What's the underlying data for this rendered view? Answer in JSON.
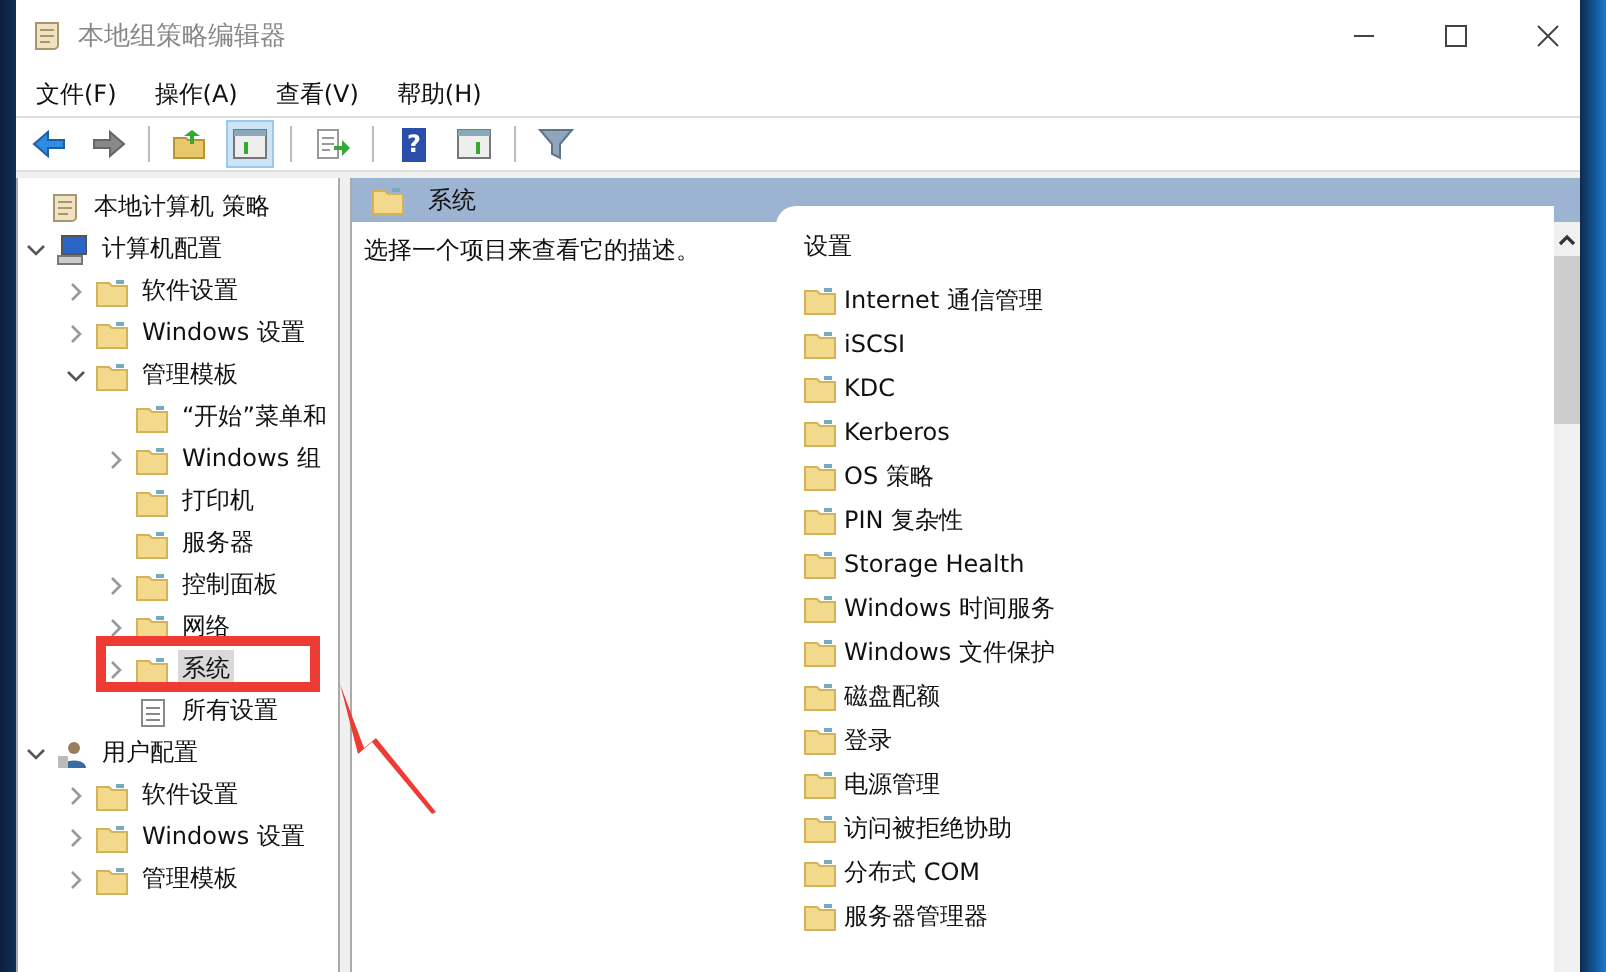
{
  "window": {
    "title": "本地组策略编辑器"
  },
  "menu": [
    "文件(F)",
    "操作(A)",
    "查看(V)",
    "帮助(H)"
  ],
  "toolbar": [
    {
      "kind": "back",
      "pressed": false
    },
    {
      "kind": "forward",
      "pressed": false
    },
    {
      "kind": "sep"
    },
    {
      "kind": "up",
      "pressed": false
    },
    {
      "kind": "pane",
      "pressed": true
    },
    {
      "kind": "sep"
    },
    {
      "kind": "export",
      "pressed": false
    },
    {
      "kind": "sep"
    },
    {
      "kind": "help",
      "label": "?",
      "pressed": false
    },
    {
      "kind": "pane2",
      "pressed": false
    },
    {
      "kind": "sep"
    },
    {
      "kind": "filter",
      "pressed": false
    }
  ],
  "tree": [
    {
      "label": "本地计算机 策略",
      "kind": "policy",
      "selected": false,
      "children": [
        {
          "label": "计算机配置",
          "kind": "computer",
          "expanded": true,
          "selected": false,
          "children": [
            {
              "label": "软件设置",
              "kind": "folder",
              "expanded": false,
              "selected": false
            },
            {
              "label": "Windows 设置",
              "kind": "folder",
              "expanded": false,
              "selected": false
            },
            {
              "label": "管理模板",
              "kind": "folder",
              "expanded": true,
              "selected": false,
              "children": [
                {
                  "label": "“开始”菜单和",
                  "kind": "folder",
                  "selected": false
                },
                {
                  "label": "Windows 组",
                  "kind": "folder",
                  "expanded": false,
                  "selected": false
                },
                {
                  "label": "打印机",
                  "kind": "folder",
                  "selected": false
                },
                {
                  "label": "服务器",
                  "kind": "folder",
                  "selected": false
                },
                {
                  "label": "控制面板",
                  "kind": "folder",
                  "expanded": false,
                  "selected": false
                },
                {
                  "label": "网络",
                  "kind": "folder",
                  "expanded": false,
                  "selected": false
                },
                {
                  "label": "系统",
                  "kind": "folder",
                  "expanded": false,
                  "selected": true
                },
                {
                  "label": "所有设置",
                  "kind": "settings",
                  "selected": false
                }
              ]
            }
          ]
        },
        {
          "label": "用户配置",
          "kind": "user",
          "expanded": true,
          "selected": false,
          "children": [
            {
              "label": "软件设置",
              "kind": "folder",
              "expanded": false,
              "selected": false
            },
            {
              "label": "Windows 设置",
              "kind": "folder",
              "expanded": false,
              "selected": false
            },
            {
              "label": "管理模板",
              "kind": "folder",
              "expanded": false,
              "selected": false
            }
          ]
        }
      ]
    }
  ],
  "header": {
    "title": "系统"
  },
  "description": "选择一个项目来查看它的描述。",
  "list": {
    "column": "设置",
    "items": [
      "Internet 通信管理",
      "iSCSI",
      "KDC",
      "Kerberos",
      "OS 策略",
      "PIN 复杂性",
      "Storage Health",
      "Windows 时间服务",
      "Windows 文件保护",
      "磁盘配额",
      "登录",
      "电源管理",
      "访问被拒绝协助",
      "分布式 COM",
      "服务器管理器"
    ]
  },
  "annotations": {
    "highlight_frame": true,
    "pointer_arrow": true
  }
}
